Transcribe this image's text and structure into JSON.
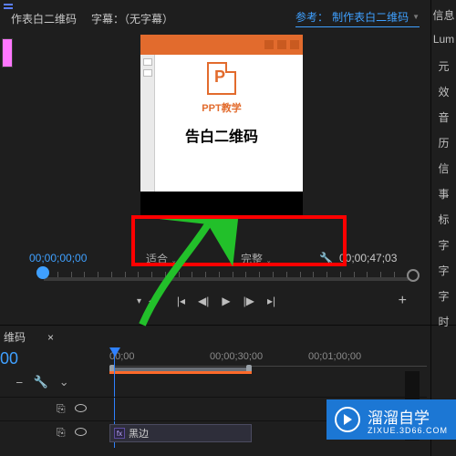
{
  "topbar": {
    "tab_label": "作表白二维码",
    "caption_label": "字幕：",
    "caption_value": "（无字幕）",
    "reference_prefix": "参考：",
    "reference_value": "制作表白二维码"
  },
  "preview": {
    "ppt_label": "PPT教学",
    "title": "告白二维码"
  },
  "transport": {
    "current_tc": "00;00;00;00",
    "fit_label": "适合",
    "full_label": "完整",
    "duration_tc": "00;00;47;03"
  },
  "sequence": {
    "name": "维码",
    "playhead_tc": "00",
    "ruler": [
      "00;00",
      "00;00;30;00",
      "00;01;00;00"
    ],
    "clip1_name": "黑边"
  },
  "right_panel": [
    "信息",
    "Lum",
    "元",
    "效",
    "音",
    "历",
    "信",
    "事",
    "标",
    "字",
    "字",
    "字",
    "时"
  ],
  "badge": {
    "text": "溜溜自学",
    "sub": "ZIXUE.3D66.COM"
  }
}
